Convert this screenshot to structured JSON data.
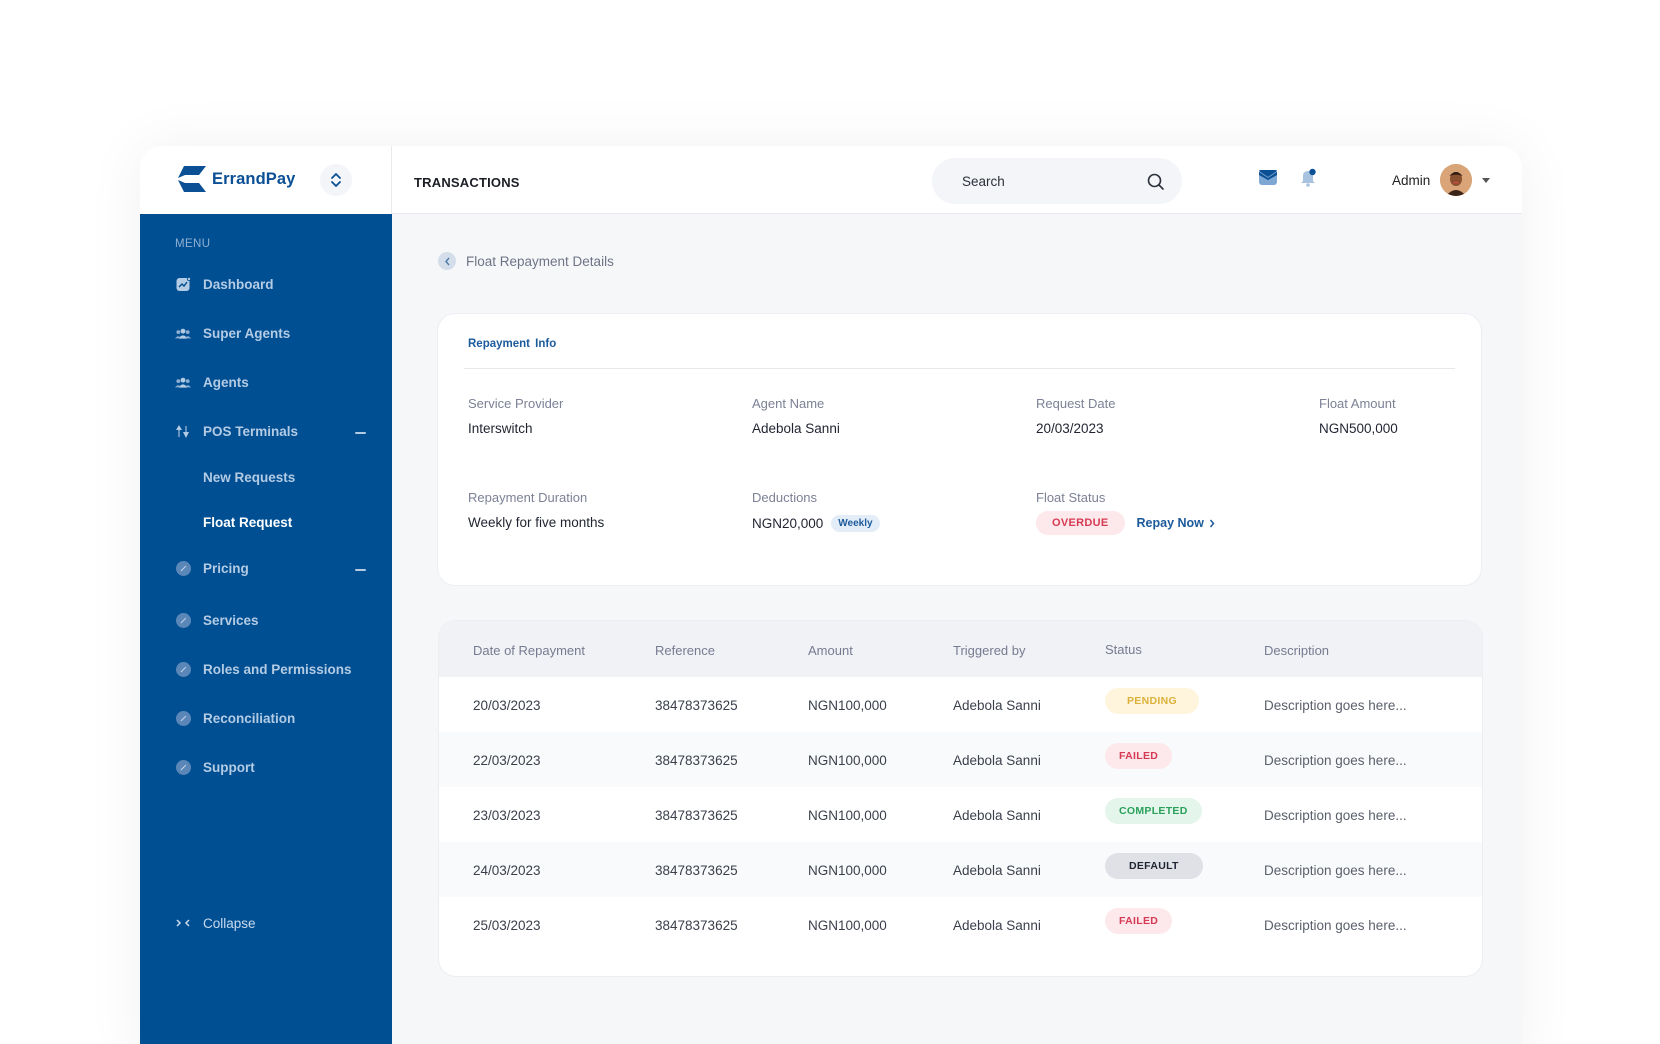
{
  "app": {
    "brand": "ErrandPay",
    "brand_color": "#0b4f95",
    "sidebar_color": "#004f93"
  },
  "sidebar": {
    "menu_title": "MENU",
    "items": [
      {
        "label": "Dashboard",
        "icon": "dashboard-icon"
      },
      {
        "label": "Super Agents",
        "icon": "users-icon"
      },
      {
        "label": "Agents",
        "icon": "users-icon"
      },
      {
        "label": "POS Terminals",
        "icon": "pos-terminal-icon",
        "expanded": true
      },
      {
        "label": "New Requests",
        "sub": true
      },
      {
        "label": "Float Request",
        "sub": true,
        "active": true
      },
      {
        "label": "Pricing",
        "icon": "badge-icon",
        "expanded": true
      },
      {
        "label": "Services",
        "icon": "badge-icon"
      },
      {
        "label": "Roles and Permissions",
        "icon": "badge-icon"
      },
      {
        "label": "Reconciliation",
        "icon": "badge-icon"
      },
      {
        "label": "Support",
        "icon": "badge-icon"
      }
    ],
    "collapse_label": "Collapse"
  },
  "header": {
    "title": "TRANSACTIONS",
    "search_placeholder": "Search",
    "user_name": "Admin"
  },
  "breadcrumb": {
    "label": "Float Repayment Details"
  },
  "repayment_info": {
    "tab": "Repayment  Info",
    "fields": [
      {
        "label": "Service Provider",
        "value": "Interswitch"
      },
      {
        "label": "Agent Name",
        "value": "Adebola Sanni"
      },
      {
        "label": "Request Date",
        "value": "20/03/2023"
      },
      {
        "label": "Float Amount",
        "value": "NGN500,000"
      },
      {
        "label": "Repayment Duration",
        "value": "Weekly for five months"
      },
      {
        "label": "Deductions",
        "value": "NGN20,000",
        "tag": "Weekly"
      },
      {
        "label": "Float Status",
        "status": "OVERDUE",
        "action": "Repay Now"
      }
    ]
  },
  "table": {
    "columns": [
      "Date of Repayment",
      "Reference",
      "Amount",
      "Triggered by",
      "Status",
      "Description"
    ],
    "rows": [
      {
        "date": "20/03/2023",
        "reference": "38478373625",
        "amount": "NGN100,000",
        "triggered_by": "Adebola Sanni",
        "status": "PENDING",
        "description": "Description goes here..."
      },
      {
        "date": "22/03/2023",
        "reference": "38478373625",
        "amount": "NGN100,000",
        "triggered_by": "Adebola Sanni",
        "status": "FAILED",
        "description": "Description goes here..."
      },
      {
        "date": "23/03/2023",
        "reference": "38478373625",
        "amount": "NGN100,000",
        "triggered_by": "Adebola Sanni",
        "status": "COMPLETED",
        "description": "Description goes here..."
      },
      {
        "date": "24/03/2023",
        "reference": "38478373625",
        "amount": "NGN100,000",
        "triggered_by": "Adebola Sanni",
        "status": "DEFAULT",
        "description": "Description goes here..."
      },
      {
        "date": "25/03/2023",
        "reference": "38478373625",
        "amount": "NGN100,000",
        "triggered_by": "Adebola Sanni",
        "status": "FAILED",
        "description": "Description goes here..."
      }
    ]
  }
}
